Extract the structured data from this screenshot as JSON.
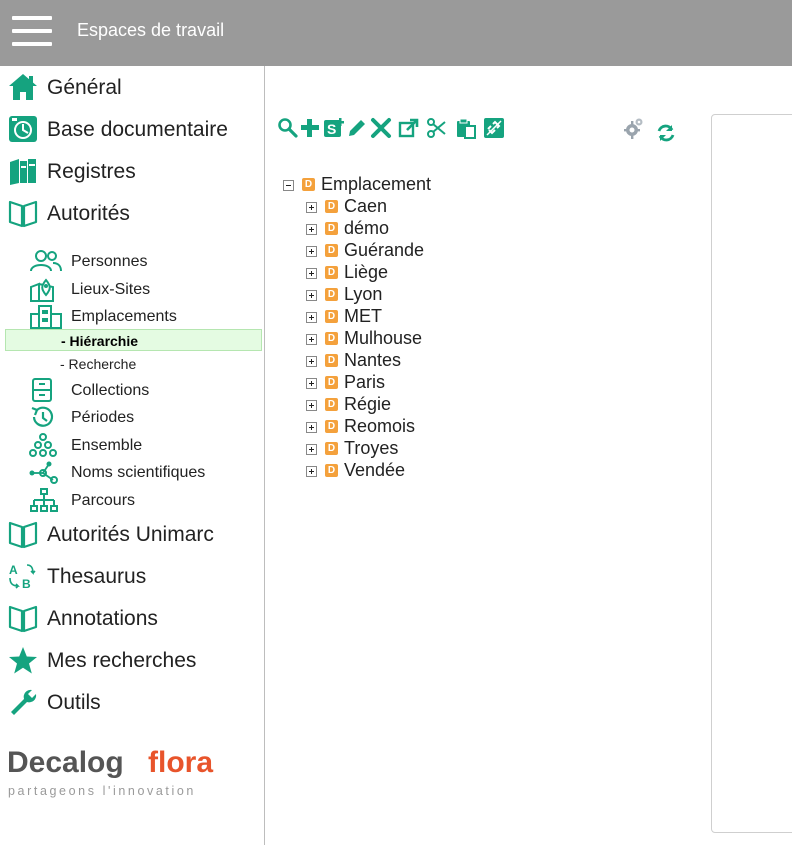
{
  "header": {
    "title": "Espaces de travail",
    "menu_icon": "hamburger-icon"
  },
  "sidebar": {
    "main_items": [
      {
        "label": "Général",
        "icon": "home-icon"
      },
      {
        "label": "Base documentaire",
        "icon": "document-base-icon"
      },
      {
        "label": "Registres",
        "icon": "books-icon"
      },
      {
        "label": "Autorités",
        "icon": "open-book-icon"
      }
    ],
    "authority_items": [
      {
        "label": "Personnes",
        "icon": "people-icon"
      },
      {
        "label": "Lieux-Sites",
        "icon": "map-pin-icon"
      },
      {
        "label": "Emplacements",
        "icon": "building-icon"
      }
    ],
    "emplacement_subitems": [
      {
        "label": "- Hiérarchie",
        "active": true
      },
      {
        "label": "- Recherche",
        "active": false
      }
    ],
    "authority_items_2": [
      {
        "label": "Collections",
        "icon": "cabinet-icon"
      },
      {
        "label": "Périodes",
        "icon": "history-icon"
      },
      {
        "label": "Ensemble",
        "icon": "cluster-icon"
      },
      {
        "label": "Noms scientifiques",
        "icon": "network-icon"
      },
      {
        "label": "Parcours",
        "icon": "org-chart-icon"
      }
    ],
    "bottom_items": [
      {
        "label": "Autorités Unimarc",
        "icon": "open-book-icon"
      },
      {
        "label": "Thesaurus",
        "icon": "abc-icon"
      },
      {
        "label": "Annotations",
        "icon": "open-book-icon"
      },
      {
        "label": "Mes recherches",
        "icon": "star-icon"
      },
      {
        "label": "Outils",
        "icon": "wrench-icon"
      }
    ]
  },
  "logo": {
    "word1": "Decalog",
    "word2": "flora",
    "tagline": "partageons l'innovation",
    "color1": "#555555",
    "color2": "#e8542b"
  },
  "toolbar": {
    "icons": [
      "search-icon",
      "add-icon",
      "add-sibling-icon",
      "edit-icon",
      "delete-icon",
      "open-external-icon",
      "cut-icon",
      "paste-icon",
      "unlink-icon"
    ],
    "right_icons": [
      "settings-icon",
      "refresh-icon"
    ]
  },
  "tree": {
    "root": {
      "label": "Emplacement",
      "badge": "D",
      "expanded": true
    },
    "children": [
      {
        "label": "Caen",
        "badge": "D"
      },
      {
        "label": "démo",
        "badge": "D"
      },
      {
        "label": "Guérande",
        "badge": "D"
      },
      {
        "label": "Liège",
        "badge": "D"
      },
      {
        "label": "Lyon",
        "badge": "D"
      },
      {
        "label": "MET",
        "badge": "D"
      },
      {
        "label": "Mulhouse",
        "badge": "D"
      },
      {
        "label": "Nantes",
        "badge": "D"
      },
      {
        "label": "Paris",
        "badge": "D"
      },
      {
        "label": "Régie",
        "badge": "D"
      },
      {
        "label": "Reomois",
        "badge": "D"
      },
      {
        "label": "Troyes",
        "badge": "D"
      },
      {
        "label": "Vendée",
        "badge": "D"
      }
    ]
  },
  "colors": {
    "accent": "#15a37f",
    "topbar": "#9a9a9a",
    "badge": "#f4a13c",
    "active_bg": "#e4fbe2"
  }
}
